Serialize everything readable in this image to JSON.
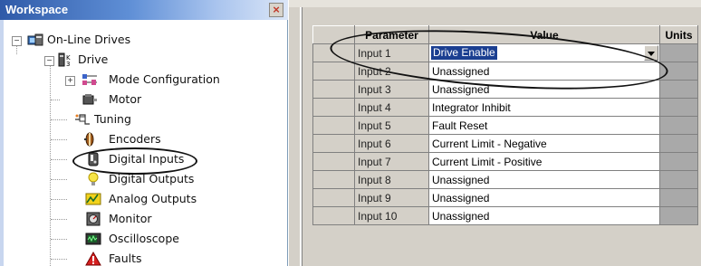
{
  "workspace": {
    "title": "Workspace",
    "close_glyph": "×",
    "tree": [
      {
        "label": "On-Line Drives",
        "icon": "online-drives-icon",
        "expander": "−"
      },
      {
        "label": "Drive",
        "icon": "drive-icon",
        "expander": "−"
      },
      {
        "label": "Mode Configuration",
        "icon": "mode-configuration-icon",
        "expander": "+"
      },
      {
        "label": "Motor",
        "icon": "motor-icon"
      },
      {
        "label": "Tuning",
        "icon": "tuning-icon"
      },
      {
        "label": "Encoders",
        "icon": "encoders-icon"
      },
      {
        "label": "Digital Inputs",
        "icon": "digital-inputs-icon"
      },
      {
        "label": "Digital Outputs",
        "icon": "digital-outputs-icon"
      },
      {
        "label": "Analog Outputs",
        "icon": "analog-outputs-icon"
      },
      {
        "label": "Monitor",
        "icon": "monitor-icon"
      },
      {
        "label": "Oscilloscope",
        "icon": "oscilloscope-icon"
      },
      {
        "label": "Faults",
        "icon": "faults-icon"
      }
    ]
  },
  "grid": {
    "headers": {
      "parameter": "Parameter",
      "value": "Value",
      "units": "Units"
    },
    "rows": [
      {
        "parameter": "Input 1",
        "value": "Drive Enable"
      },
      {
        "parameter": "Input 2",
        "value": "Unassigned"
      },
      {
        "parameter": "Input 3",
        "value": "Unassigned"
      },
      {
        "parameter": "Input 4",
        "value": "Integrator Inhibit"
      },
      {
        "parameter": "Input 5",
        "value": "Fault Reset"
      },
      {
        "parameter": "Input 6",
        "value": "Current Limit - Negative"
      },
      {
        "parameter": "Input 7",
        "value": "Current Limit - Positive"
      },
      {
        "parameter": "Input 8",
        "value": "Unassigned"
      },
      {
        "parameter": "Input 9",
        "value": "Unassigned"
      },
      {
        "parameter": "Input 10",
        "value": "Unassigned"
      }
    ]
  },
  "colors": {
    "selection": "#1b3f91",
    "title_bar": "#2f5aa8",
    "units_column": "#a9a9a9"
  }
}
